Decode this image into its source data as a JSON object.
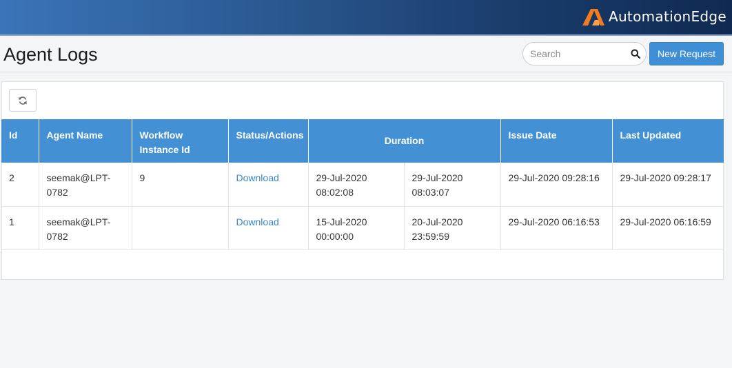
{
  "brand": {
    "name": "AutomationEdge",
    "accent": "#f47b20"
  },
  "header": {
    "title": "Agent Logs",
    "search_placeholder": "Search",
    "search_value": "",
    "new_request_label": "New Request"
  },
  "table": {
    "columns": [
      "Id",
      "Agent Name",
      "Workflow Instance Id",
      "Status/Actions",
      "Duration",
      "Issue Date",
      "Last Updated"
    ],
    "rows": [
      {
        "id": "2",
        "agent": "seemak@LPT-0782",
        "workflow_id": "9",
        "action": "Download",
        "start": "29-Jul-2020 08:02:08",
        "end": "29-Jul-2020 08:03:07",
        "issue_date": "29-Jul-2020 09:28:16",
        "last_updated": "29-Jul-2020 09:28:17"
      },
      {
        "id": "1",
        "agent": "seemak@LPT-0782",
        "workflow_id": "",
        "action": "Download",
        "start": "15-Jul-2020 00:00:00",
        "end": "20-Jul-2020 23:59:59",
        "issue_date": "29-Jul-2020 06:16:53",
        "last_updated": "29-Jul-2020 06:16:59"
      }
    ]
  },
  "icons": {
    "logo": "automationedge-logo-icon",
    "search": "search-icon",
    "refresh": "refresh-icon"
  }
}
